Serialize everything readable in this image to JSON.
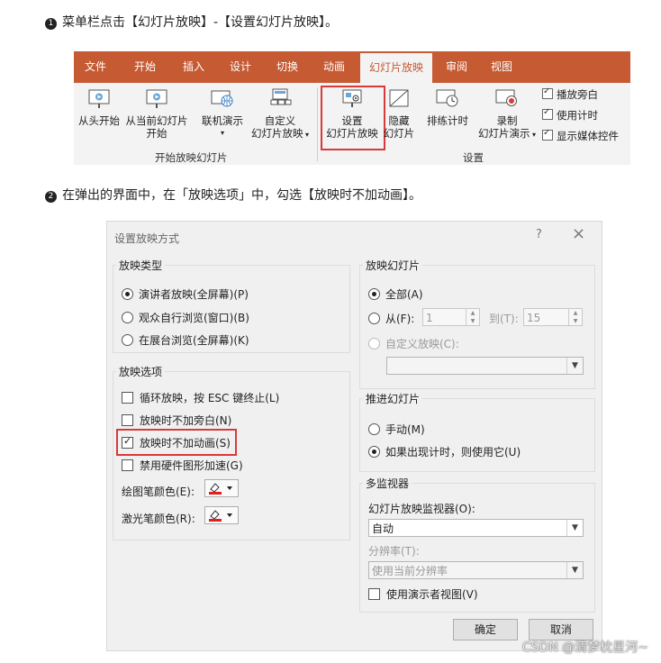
{
  "steps": {
    "step1": {
      "num": "1",
      "text": "菜单栏点击【幻灯片放映】-【设置幻灯片放映】。"
    },
    "step2": {
      "num": "2",
      "text": "在弹出的界面中，在「放映选项」中，勾选【放映时不加动画】。"
    }
  },
  "ribbon": {
    "tabs": [
      "文件",
      "开始",
      "插入",
      "设计",
      "切换",
      "动画",
      "幻灯片放映",
      "审阅",
      "视图"
    ],
    "active_tab": "幻灯片放映",
    "start_group": {
      "label": "开始放映幻灯片",
      "from_beginning": "从头开始",
      "from_current_line1": "从当前幻灯片",
      "from_current_line2": "开始",
      "online_present": "联机演示",
      "custom_line1": "自定义",
      "custom_line2": "幻灯片放映"
    },
    "setup_group": {
      "label": "设置",
      "setup_line1": "设置",
      "setup_line2": "幻灯片放映",
      "hide_line1": "隐藏",
      "hide_line2": "幻灯片",
      "rehearse": "排练计时",
      "record_line1": "录制",
      "record_line2": "幻灯片演示"
    },
    "checks": [
      {
        "label": "播放旁白",
        "checked": true
      },
      {
        "label": "使用计时",
        "checked": true
      },
      {
        "label": "显示媒体控件",
        "checked": true
      }
    ],
    "accent": "#c55a33"
  },
  "dialog": {
    "title": "设置放映方式",
    "help": "?",
    "close": "×",
    "show_type": {
      "title": "放映类型",
      "options": [
        "演讲者放映(全屏幕)(P)",
        "观众自行浏览(窗口)(B)",
        "在展台浏览(全屏幕)(K)"
      ],
      "selected": 0
    },
    "show_options": {
      "title": "放映选项",
      "loop": "循环放映，按 ESC 键终止(L)",
      "no_narration": "放映时不加旁白(N)",
      "no_animation": "放映时不加动画(S)",
      "no_hw_accel": "禁用硬件图形加速(G)",
      "pen_color": "绘图笔颜色(E):",
      "laser_color": "激光笔颜色(R):"
    },
    "slides": {
      "title": "放映幻灯片",
      "all": "全部(A)",
      "from": "从(F):",
      "from_value": "1",
      "to": "到(T):",
      "to_value": "15",
      "custom": "自定义放映(C):"
    },
    "advance": {
      "title": "推进幻灯片",
      "manual": "手动(M)",
      "timings": "如果出现计时，则使用它(U)"
    },
    "monitors": {
      "title": "多监视器",
      "monitor_label": "幻灯片放映监视器(O):",
      "monitor_value": "自动",
      "resolution_label": "分辨率(T):",
      "resolution_value": "使用当前分辨率",
      "presenter_view": "使用演示者视图(V)"
    },
    "ok": "确定",
    "cancel": "取消"
  },
  "watermark": "CSDN @清梦枕星河~"
}
